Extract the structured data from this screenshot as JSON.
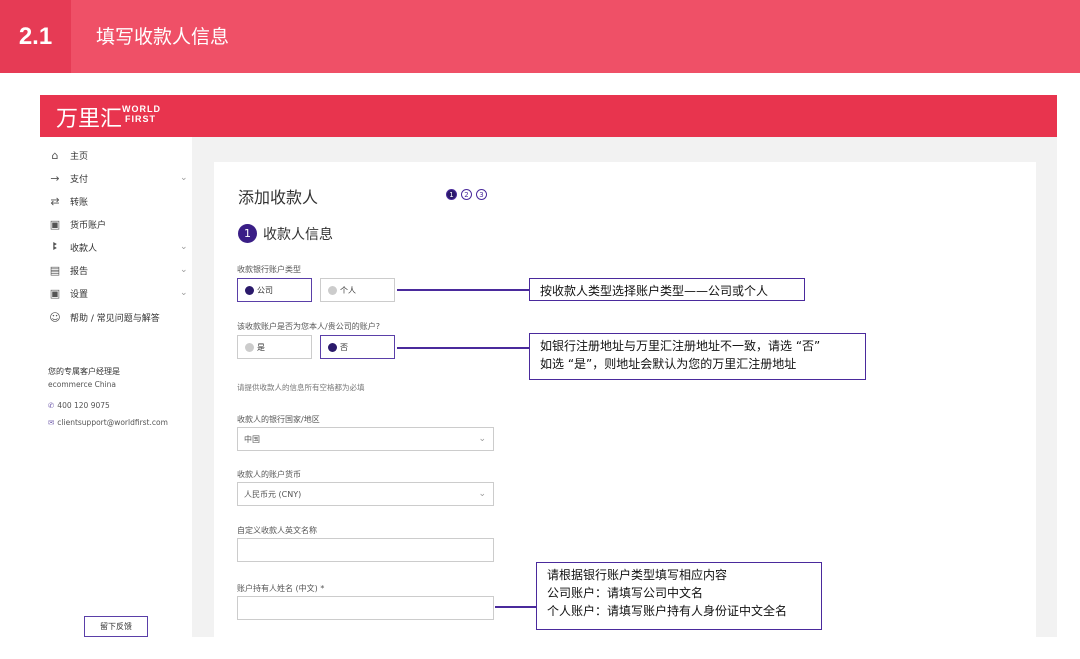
{
  "slide": {
    "number": "2.1",
    "title": "填写收款人信息"
  },
  "brand": {
    "name_cn": "万里汇",
    "name_en_1": "WORLD",
    "name_en_2": "FIRST"
  },
  "sidebar": {
    "items": [
      {
        "label": "主页",
        "icon": "home-icon",
        "glyph": "⌂",
        "chevron": ""
      },
      {
        "label": "支付",
        "icon": "arrow-right-icon",
        "glyph": "→",
        "chevron": "⌄"
      },
      {
        "label": "转账",
        "icon": "transfer-icon",
        "glyph": "⇄",
        "chevron": ""
      },
      {
        "label": "货币账户",
        "icon": "wallet-icon",
        "glyph": "▣",
        "chevron": ""
      },
      {
        "label": "收款人",
        "icon": "users-icon",
        "glyph": "ꔪ",
        "chevron": "⌄"
      },
      {
        "label": "报告",
        "icon": "report-icon",
        "glyph": "▤",
        "chevron": "⌄"
      },
      {
        "label": "设置",
        "icon": "settings-icon",
        "glyph": "▣",
        "chevron": "⌄"
      },
      {
        "label": "帮助 / 常见问题与解答",
        "icon": "help-icon",
        "glyph": "☺",
        "chevron": ""
      }
    ],
    "manager_label": "您的专属客户经理是",
    "manager_name": "ecommerce China",
    "phone": "400 120 9075",
    "email": "clientsupport@worldfirst.com",
    "feedback_label": "留下反馈"
  },
  "form": {
    "heading": "添加收款人",
    "steps": [
      "1",
      "2",
      "3"
    ],
    "section_number": "1",
    "section_title": "收款人信息",
    "account_type_label": "收款银行账户类型",
    "account_type_options": [
      "公司",
      "个人"
    ],
    "same_address_label": "该收款账户是否为您本人/贵公司的账户?",
    "same_address_options": [
      "是",
      "否"
    ],
    "required_note": "请提供收款人的信息所有空格都为必填",
    "country_label": "收款人的银行国家/地区",
    "country_value": "中国",
    "currency_label": "收款人的账户货币",
    "currency_value": "人民币元 (CNY)",
    "nickname_label": "自定义收款人英文名称",
    "holder_label": "账户持有人姓名 (中文) *"
  },
  "callouts": {
    "c1": "按收款人类型选择账户类型——公司或个人",
    "c2_line1": "如银行注册地址与万里汇注册地址不一致，请选 “否”",
    "c2_line2": "如选 “是”，则地址会默认为您的万里汇注册地址",
    "c3_line1": "请根据银行账户类型填写相应内容",
    "c3_line2": "公司账户：请填写公司中文名",
    "c3_line3": "个人账户：请填写账户持有人身份证中文全名"
  },
  "colors": {
    "header": "#ef5067",
    "app_bar": "#e8344e",
    "accent": "#4a2a9c"
  }
}
